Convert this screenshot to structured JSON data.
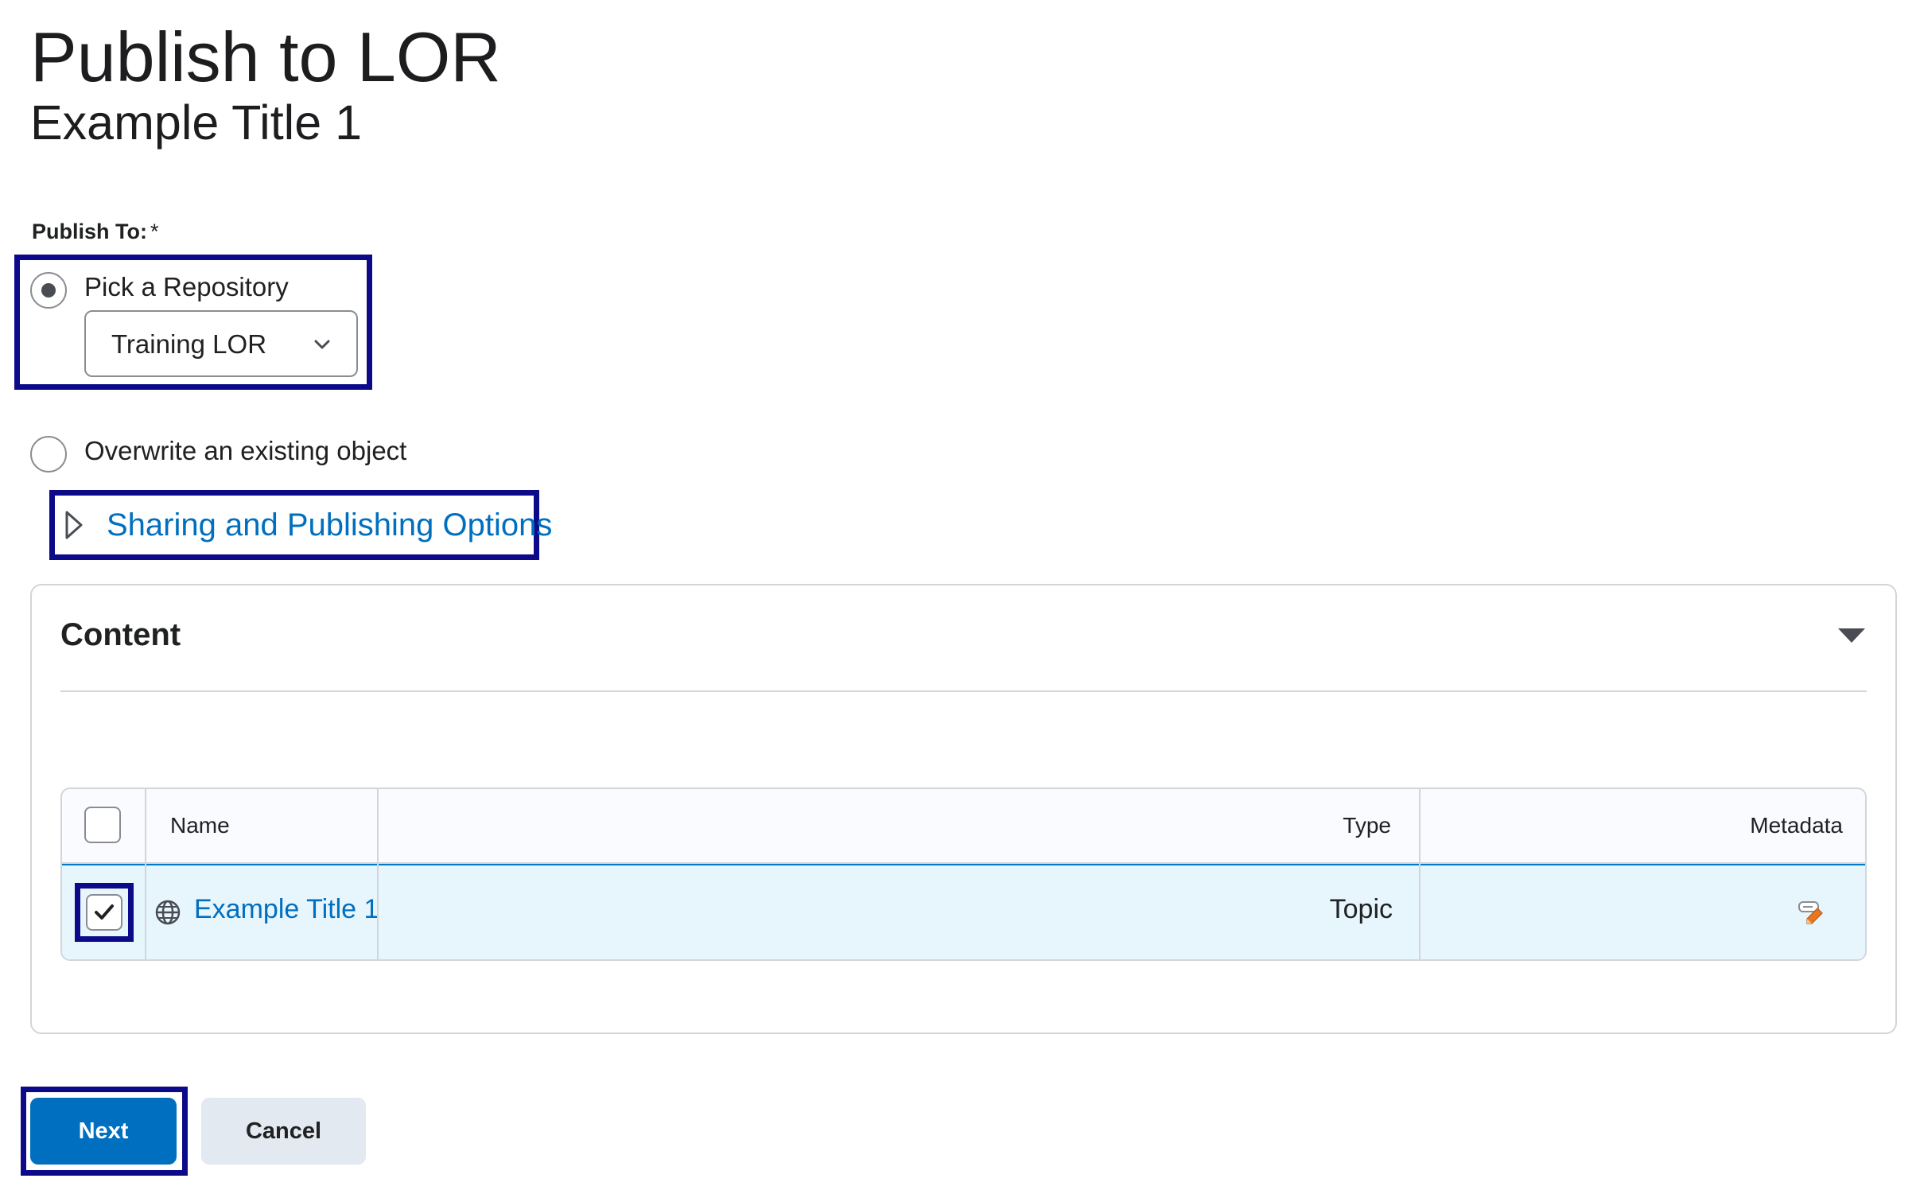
{
  "page": {
    "title": "Publish to LOR",
    "subtitle": "Example Title 1"
  },
  "publish_to": {
    "label": "Publish To:",
    "required_marker": "*",
    "options": [
      {
        "label": "Pick a Repository",
        "selected": true
      },
      {
        "label": "Overwrite an existing object",
        "selected": false
      }
    ],
    "repository_select": {
      "value": "Training LOR"
    }
  },
  "sharing": {
    "label": "Sharing and Publishing Options",
    "expanded": false
  },
  "content": {
    "title": "Content",
    "collapsed_state": "expanded",
    "columns": {
      "name": "Name",
      "type": "Type",
      "metadata": "Metadata"
    },
    "rows": [
      {
        "name": "Example Title 1",
        "type": "Topic",
        "selected": true,
        "icon": "globe-icon",
        "metadata_icon": "edit-metadata-icon"
      }
    ]
  },
  "actions": {
    "next_label": "Next",
    "cancel_label": "Cancel"
  },
  "colors": {
    "link": "#006fbf",
    "primary_button": "#006fbf",
    "highlight_outline": "#0d0a8a",
    "selected_row_bg": "#e7f6fd"
  }
}
